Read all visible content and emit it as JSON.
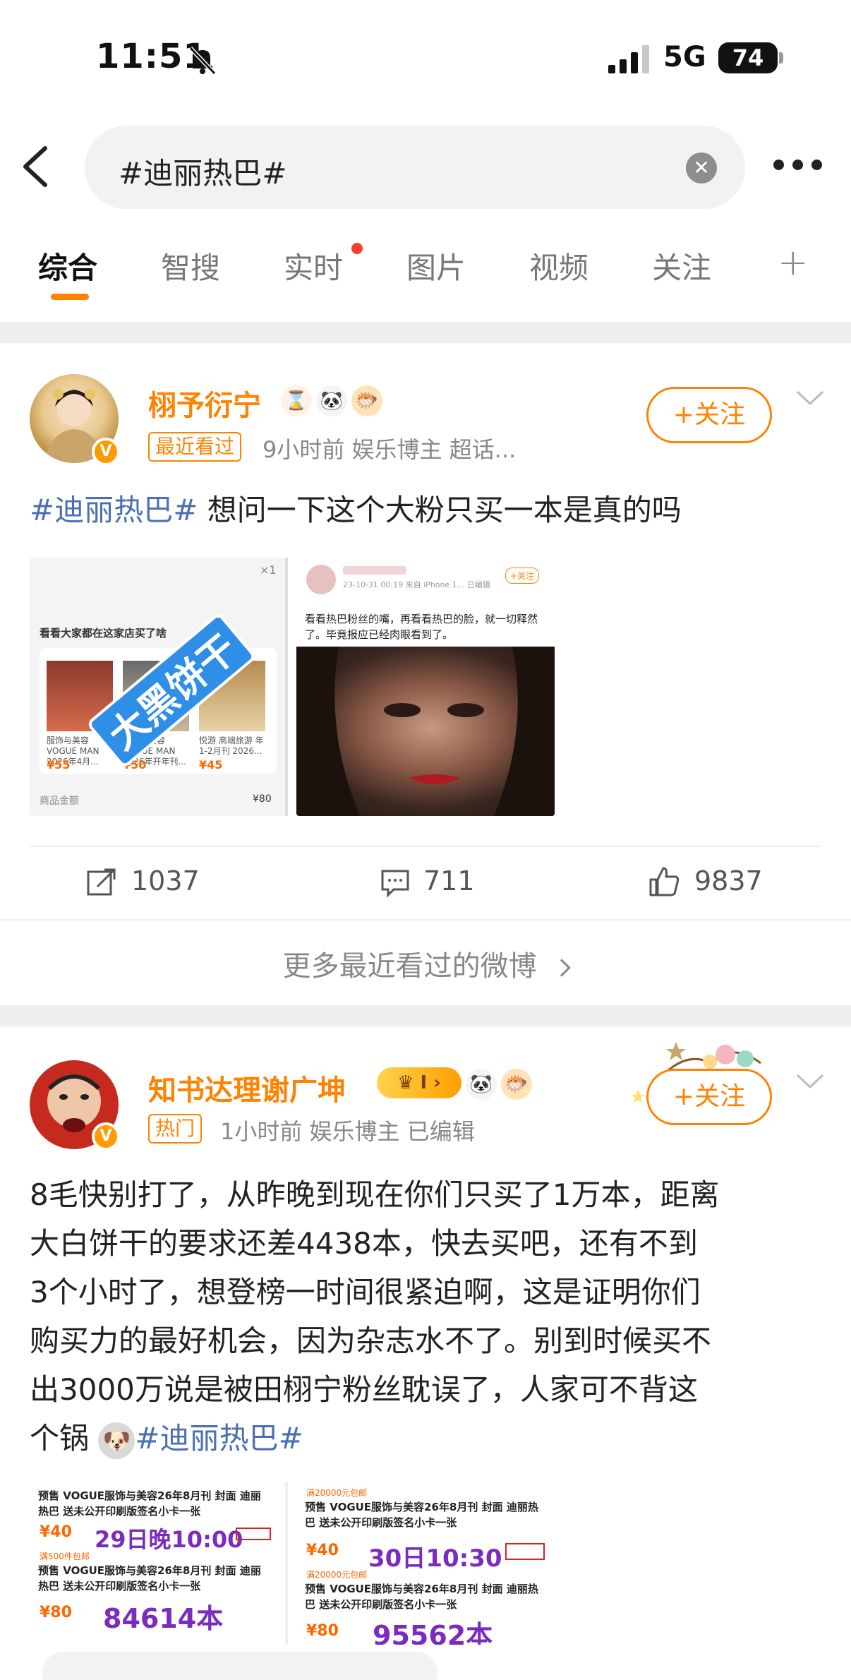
{
  "status": {
    "time": "11:51",
    "network": "5G",
    "battery": "74"
  },
  "search": {
    "query": "#迪丽热巴#"
  },
  "tabs": [
    {
      "label": "综合",
      "active": true
    },
    {
      "label": "智搜",
      "active": false
    },
    {
      "label": "实时",
      "active": false,
      "dot": true
    },
    {
      "label": "图片",
      "active": false
    },
    {
      "label": "视频",
      "active": false
    },
    {
      "label": "关注",
      "active": false
    }
  ],
  "colors": {
    "accent": "#ff8200",
    "hashtag": "#4a6fb5",
    "separator": "#efefef"
  },
  "post1": {
    "username": "栩予衍宁",
    "badges": [
      "hourglass-icon",
      "panda-icon",
      "fish-icon"
    ],
    "tag": "最近看过",
    "meta": "9小时前   娱乐博主 超话...",
    "follow": "+关注",
    "text_hashtag": "#迪丽热巴#",
    "text_body": " 想问一下这个大粉只买一本是真的吗",
    "image1": {
      "header": "看看大家都在这家店买了啥",
      "stamp": "大黑饼干",
      "items": [
        {
          "title": "服饰与美容VOGUE MAN 2026年4月...",
          "price": "¥55"
        },
        {
          "title": "服饰与美容VOGUE MAN 2026年开年刊...",
          "price": "¥50"
        },
        {
          "title": "悦游 高端旅游 年1-2月刊 2026...",
          "price": "¥45"
        }
      ],
      "footer_label": "商品金额",
      "footer_value": "¥80"
    },
    "image2": {
      "caption": "看看热巴粉丝的嘴，再看看热巴的脸，就一切释然了。毕竟报应已经肉眼看到了。",
      "meta": "23-10-31 00:19  来自 iPhone 1...  已编辑"
    },
    "actions": {
      "share": "1037",
      "comment": "711",
      "like": "9837"
    },
    "more_link": "更多最近看过的微博"
  },
  "post2": {
    "username": "知书达理谢广坤",
    "badges": [
      "crown-level-icon",
      "panda-icon",
      "fish-icon"
    ],
    "tag": "热门",
    "meta": "1小时前   娱乐博主   已编辑",
    "follow": "+关注",
    "lines": [
      "8毛快别打了，从昨晚到现在你们只买了1万本，距离",
      "大白饼干的要求还差4438本，快去买吧，还有不到",
      "3个小时了，想登榜一时间很紧迫啊，这是证明你们",
      "购买力的最好机会，因为杂志水不了。别到时候买不",
      "出3000万说是被田栩宁粉丝耽误了，人家可不背这"
    ],
    "last_line_prefix": "个锅",
    "last_line_hashtag": "#迪丽热巴#",
    "image1": {
      "product": "预售 VOGUE服饰与美容26年8月刊 封面 迪丽热巴 送未公开印刷版签名小卡一张",
      "price": "¥40",
      "time": "29日晚10:00",
      "promo": "满500件包邮",
      "price2": "¥80",
      "count": "84614本"
    },
    "image2": {
      "promo": "满20000元包邮",
      "product": "预售 VOGUE服饰与美容26年8月刊 封面 迪丽热巴 送未公开印刷版签名小卡一张",
      "price": "¥40",
      "time": "30日10:30",
      "price2": "¥80",
      "count": "95562本"
    }
  }
}
